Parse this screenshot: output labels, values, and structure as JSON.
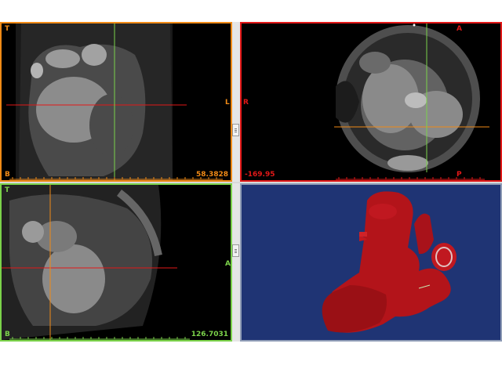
{
  "app": {
    "title": "",
    "colors": {
      "axial": "#f08a16",
      "sagittal": "#e21818",
      "coronal": "#7bd24a",
      "volume_bg": "#1f3474"
    }
  },
  "viewports": {
    "top_left": {
      "orientation_top": "T",
      "orientation_right": "L",
      "orientation_bottom": "B",
      "position_value": "58.3828"
    },
    "top_right": {
      "orientation_top": "A",
      "orientation_left": "R",
      "orientation_bottom": "P",
      "position_value": "-169.95"
    },
    "bottom_left": {
      "orientation_top": "T",
      "orientation_right": "A",
      "orientation_bottom": "B",
      "position_value": "126.7031"
    },
    "bottom_right": {
      "render_type": "3d-volume-rendering",
      "icon": "heart-3d-model"
    }
  }
}
